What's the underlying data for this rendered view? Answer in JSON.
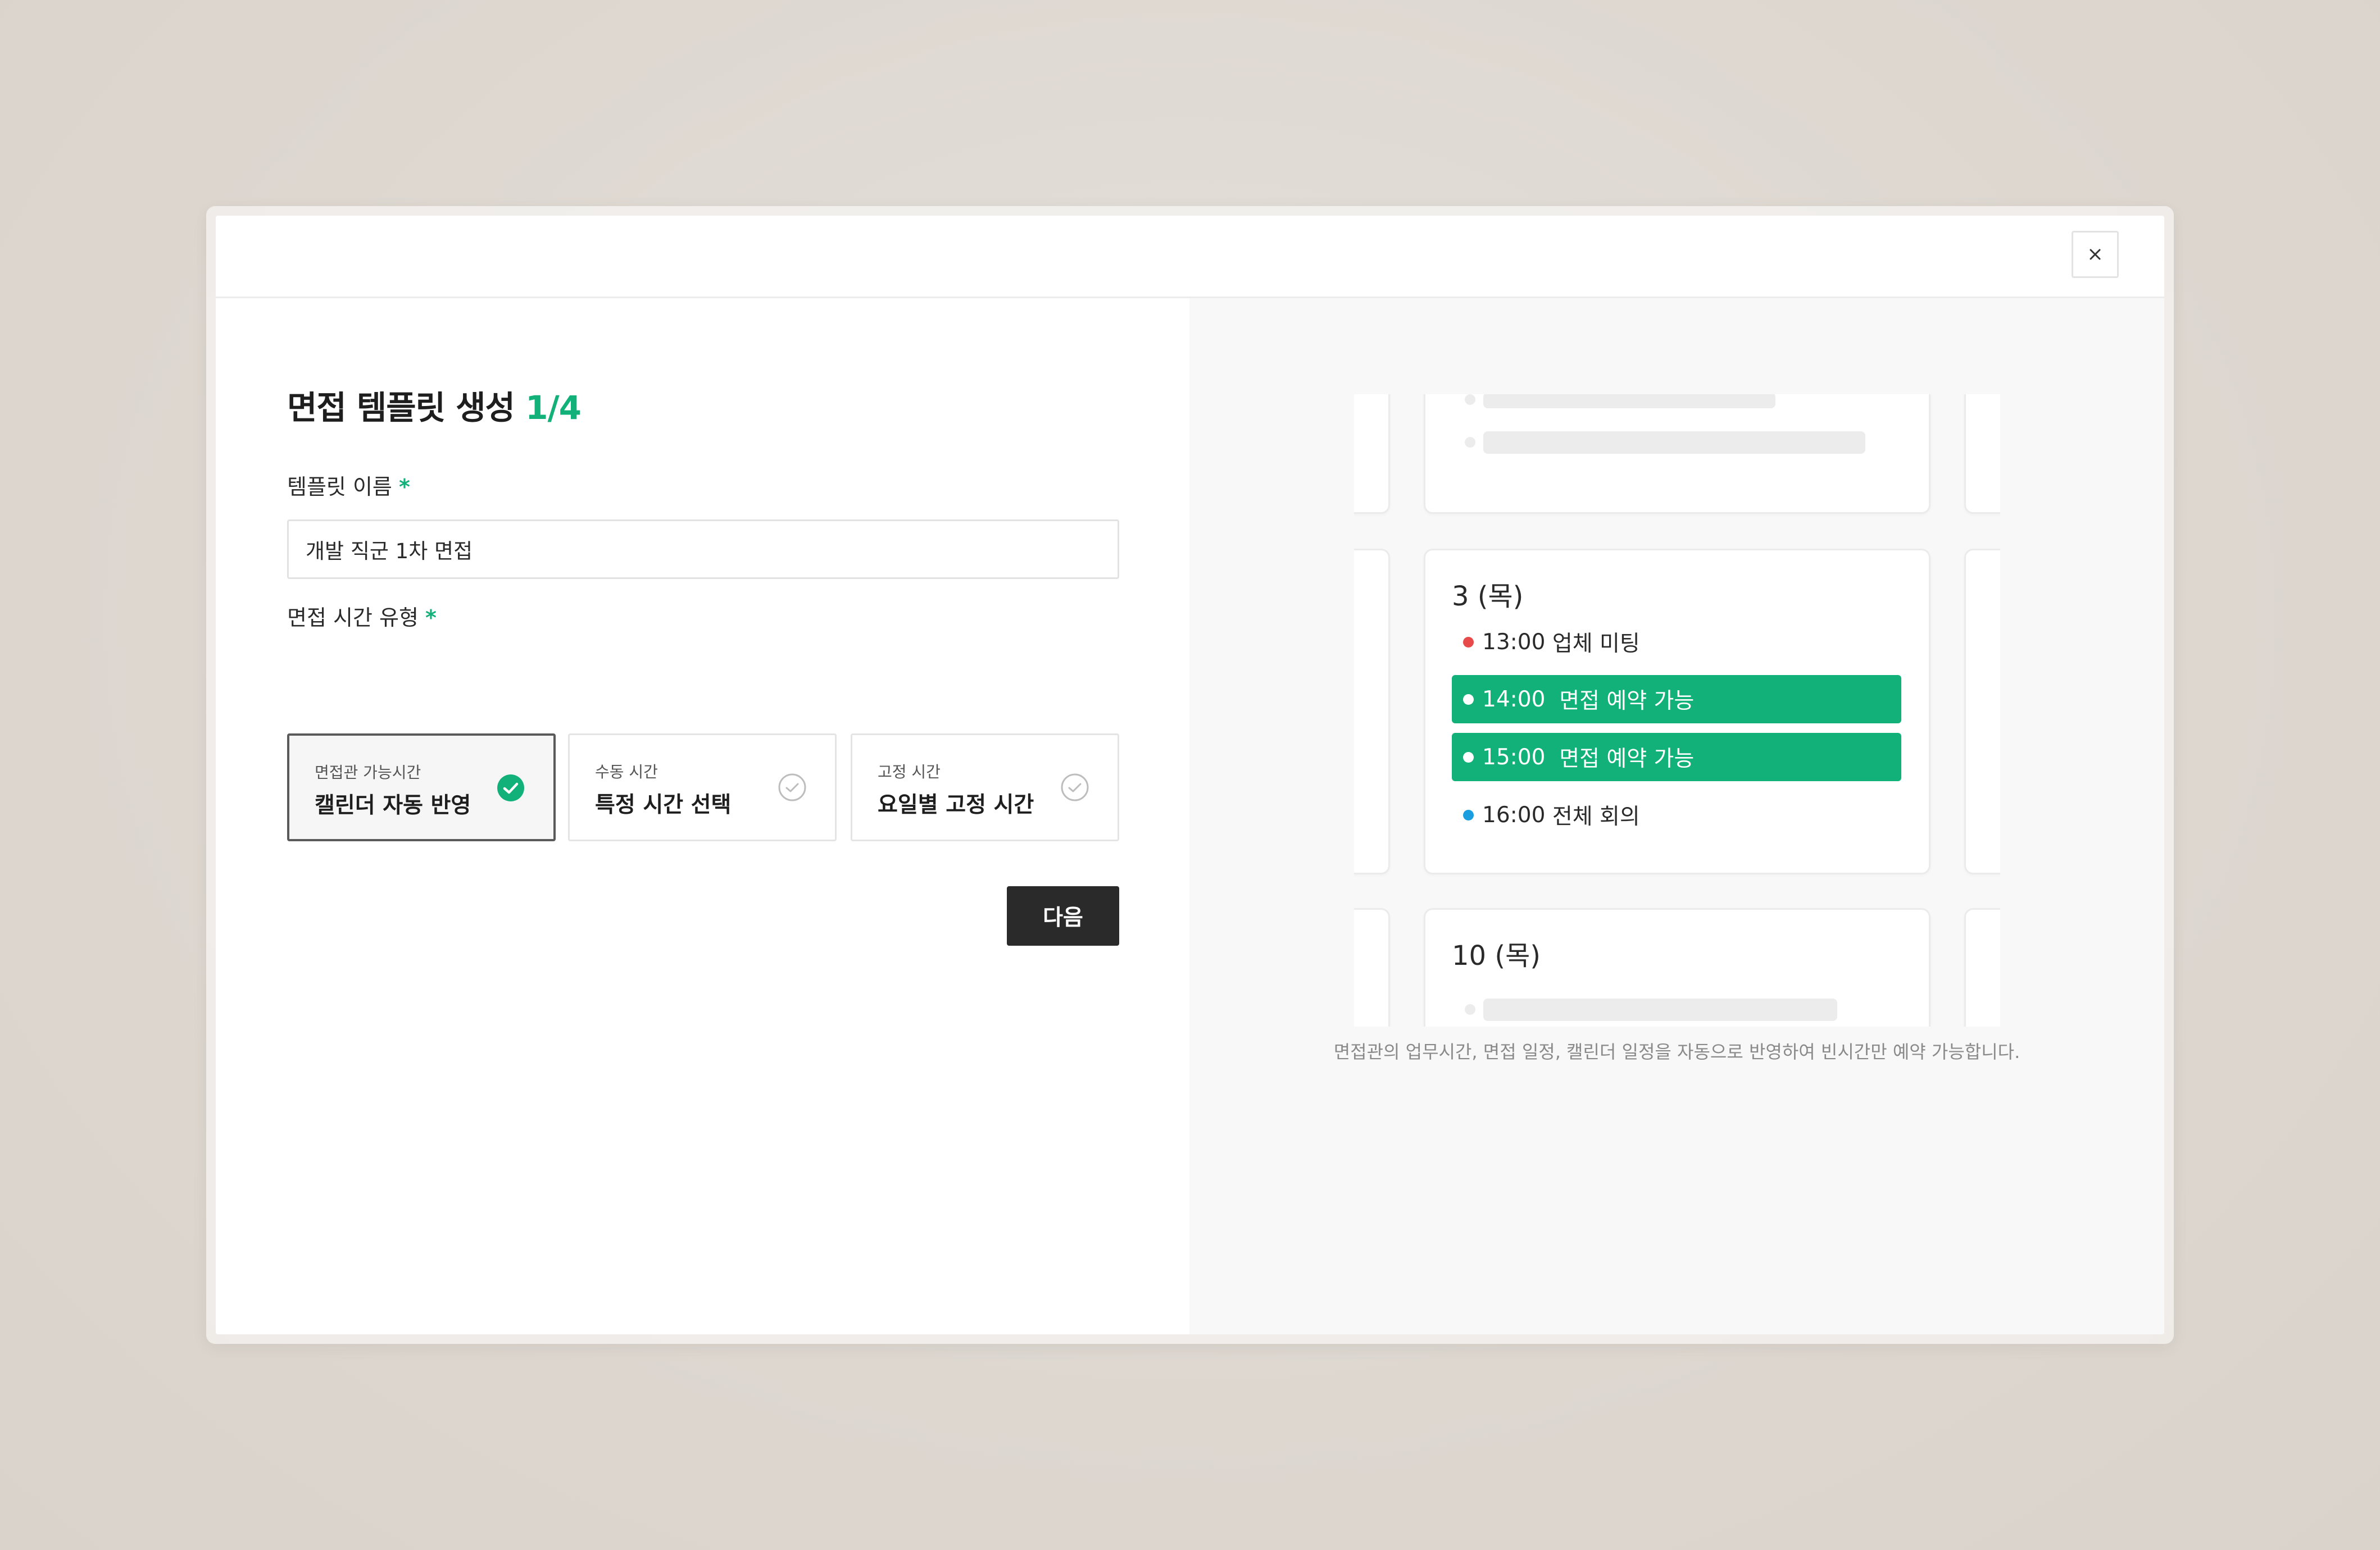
{
  "modal": {
    "close_label": "×"
  },
  "form": {
    "title": "면접 템플릿 생성",
    "step": "1/4",
    "template_name_label": "템플릿 이름",
    "required_mark": "*",
    "template_name_value": "개발 직군 1차 면접",
    "time_type_label": "면접 시간 유형",
    "options": [
      {
        "sub": "면접관 가능시간",
        "main": "캘린더 자동 반영",
        "selected": true
      },
      {
        "sub": "수동 시간",
        "main": "특정 시간 선택",
        "selected": false
      },
      {
        "sub": "고정 시간",
        "main": "요일별 고정 시간",
        "selected": false
      }
    ],
    "next_label": "다음"
  },
  "preview": {
    "cards": [
      {
        "date": "3 (목)",
        "events": [
          {
            "time": "13:00",
            "title": "업체 미팅",
            "kind": "busy",
            "dot_color": "#e84a4a"
          },
          {
            "time": "14:00",
            "title": "면접 예약 가능",
            "kind": "available",
            "dot_color": "#ffffff"
          },
          {
            "time": "15:00",
            "title": "면접 예약 가능",
            "kind": "available",
            "dot_color": "#ffffff"
          },
          {
            "time": "16:00",
            "title": "전체 회의",
            "kind": "meeting",
            "dot_color": "#1a9ee0"
          }
        ]
      },
      {
        "date": "10 (목)",
        "events": []
      }
    ],
    "caption": "면접관의 업무시간, 면접 일정, 캘린더 일정을 자동으로 반영하여 빈시간만 예약 가능합니다."
  },
  "colors": {
    "accent": "#12b17a",
    "dark_button": "#2a2a2a",
    "busy_dot": "#e84a4a",
    "meeting_dot": "#1a9ee0"
  }
}
